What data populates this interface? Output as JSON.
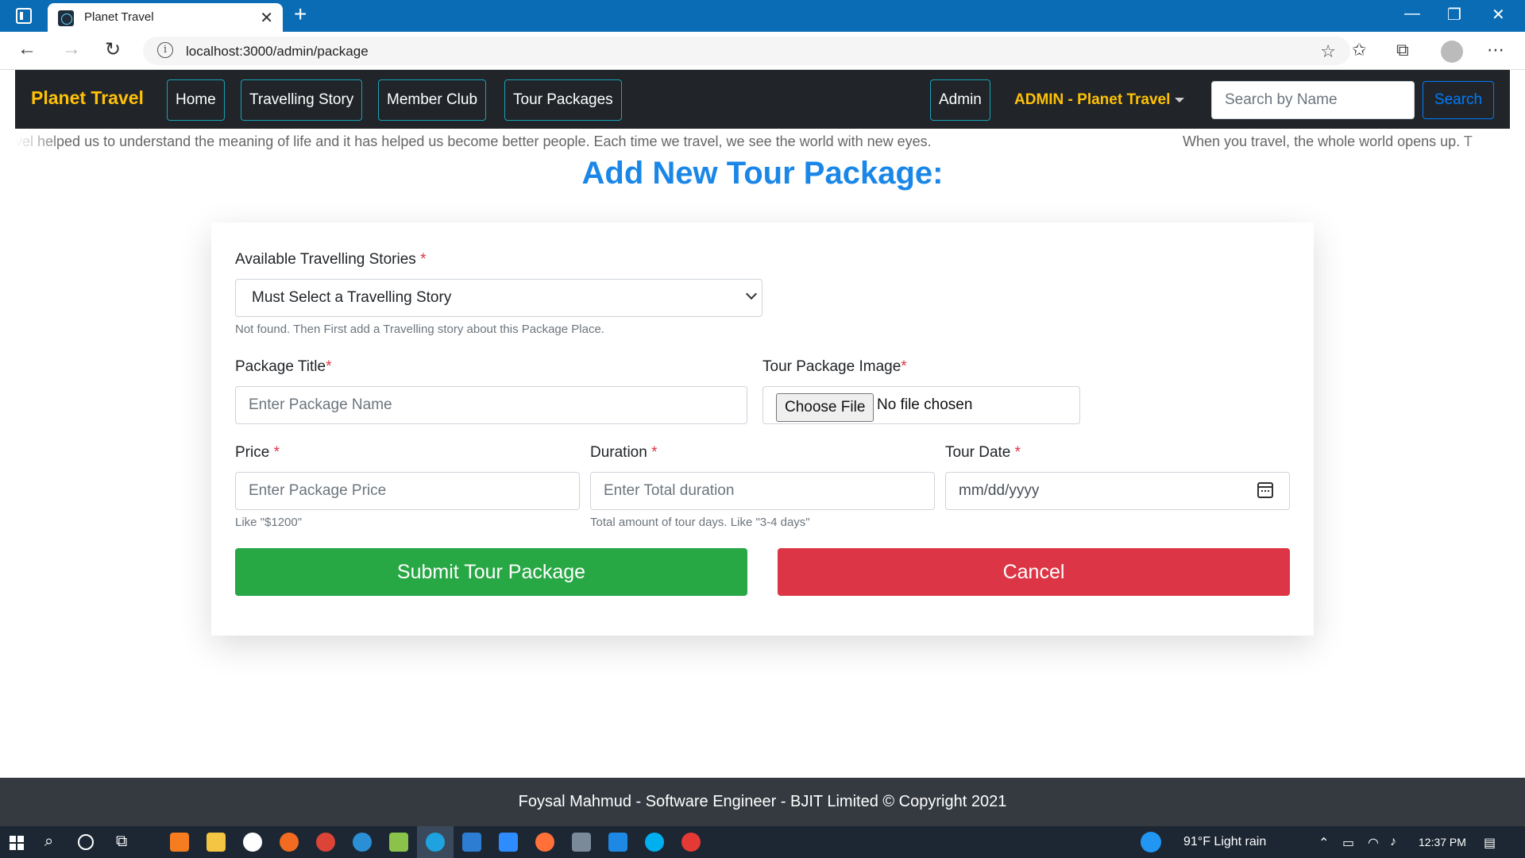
{
  "browser": {
    "tab_title": "Planet Travel",
    "tab_close": "✕",
    "new_tab": "+",
    "url": "localhost:3000/admin/package",
    "window_controls": [
      "—",
      "❐",
      "✕"
    ]
  },
  "navbar": {
    "brand": "Planet Travel",
    "links": [
      "Home",
      "Travelling Story",
      "Member Club",
      "Tour Packages"
    ],
    "admin_link": "Admin",
    "admin_dropdown": "ADMIN - Planet Travel",
    "search_placeholder": "Search by Name",
    "search_button": "Search",
    "brand_color": "#ffc107",
    "outline_color": "#17a2b8"
  },
  "marquee": {
    "text_left": "vel helped us to understand the meaning of life and it has helped us become better people. Each time we travel, we see the world with new eyes.",
    "text_right": "When you travel, the whole world opens up. T"
  },
  "page": {
    "heading": "Add New Tour Package:"
  },
  "form": {
    "stories_label": "Available Travelling Stories",
    "stories_selected": "Must Select a Travelling Story",
    "stories_help": "Not found. Then First add a Travelling story about this Package Place.",
    "title_label": "Package Title",
    "title_placeholder": "Enter Package Name",
    "image_label": "Tour Package Image",
    "file_button": "Choose File",
    "file_status": "No file chosen",
    "price_label": "Price",
    "price_placeholder": "Enter Package Price",
    "price_help": "Like \"$1200\"",
    "duration_label": "Duration",
    "duration_placeholder": "Enter Total duration",
    "duration_help": "Total amount of tour days. Like \"3-4 days\"",
    "date_label": "Tour Date",
    "date_placeholder": "mm/dd/yyyy",
    "required_mark": "*",
    "submit": "Submit Tour Package",
    "cancel": "Cancel",
    "submit_color": "#28a745",
    "cancel_color": "#dc3545"
  },
  "footer": {
    "text": "Foysal Mahmud - Software Engineer - BJIT Limited © Copyright 2021"
  },
  "taskbar": {
    "weather": "91°F  Light rain",
    "time": "12:37 PM"
  }
}
